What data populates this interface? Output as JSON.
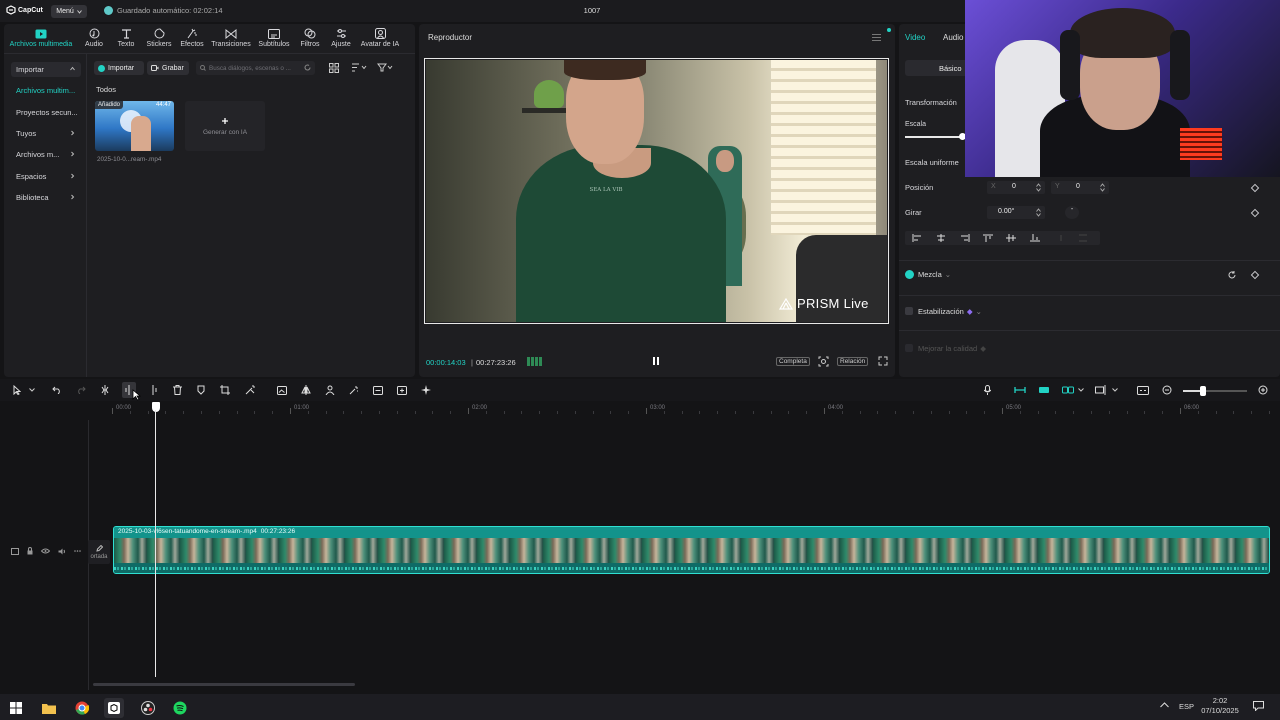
{
  "app": {
    "logo": "CapCut",
    "menu_label": "Menú",
    "autosave": "Guardado automático: 02:02:14",
    "project_title": "1007"
  },
  "media_tabs": [
    {
      "label": "Archivos multimedia",
      "icon": "media-icon"
    },
    {
      "label": "Audio",
      "icon": "audio-icon"
    },
    {
      "label": "Texto",
      "icon": "text-icon"
    },
    {
      "label": "Stickers",
      "icon": "sticker-icon"
    },
    {
      "label": "Efectos",
      "icon": "effects-icon"
    },
    {
      "label": "Transiciones",
      "icon": "transition-icon"
    },
    {
      "label": "Subtítulos",
      "icon": "subtitle-icon"
    },
    {
      "label": "Filtros",
      "icon": "filter-icon"
    },
    {
      "label": "Ajuste",
      "icon": "adjust-icon"
    },
    {
      "label": "Avatar de IA",
      "icon": "avatar-icon"
    }
  ],
  "sidebar": [
    {
      "label": "Importar"
    },
    {
      "label": "Archivos multim..."
    },
    {
      "label": "Proyectos secun..."
    },
    {
      "label": "Tuyos"
    },
    {
      "label": "Archivos m..."
    },
    {
      "label": "Espacios"
    },
    {
      "label": "Biblioteca"
    }
  ],
  "media_toolbar": {
    "import_label": "Importar",
    "record_label": "Grabar",
    "search_placeholder": "Busca diálogos, escenas o ..."
  },
  "media_grid": {
    "section_label": "Todos",
    "clip": {
      "badge": "Añadido",
      "duration": "44:47",
      "filename": "2025-10-0...ream-.mp4"
    },
    "generate_label": "Generar con IA"
  },
  "player": {
    "title": "Reproductor",
    "watermark": "PRISM Live",
    "shirt_text": "SEA LA VIB",
    "current_time": "00:00:14:03",
    "total_time": "00:27:23:26",
    "full_label": "Completa",
    "ratio_label": "Relación"
  },
  "properties": {
    "tabs": [
      "Video",
      "Audio"
    ],
    "subtab": "Básico",
    "transform_label": "Transformación",
    "scale_label": "Escala",
    "uniform_scale_label": "Escala uniforme",
    "position_label": "Posición",
    "pos_x_label": "X",
    "pos_x": "0",
    "pos_y_label": "Y",
    "pos_y": "0",
    "rotate_label": "Girar",
    "rotate_value": "0.00°",
    "rotate_extra": "-",
    "blend_label": "Mezcla",
    "stabilize_label": "Estabilización",
    "enhance_label": "Mejorar la calidad"
  },
  "timeline": {
    "ruler_labels": [
      "00:00",
      "01:00",
      "02:00",
      "03:00",
      "04:00",
      "05:00",
      "06:00"
    ],
    "track_cover_label": "ortada",
    "clip_name": "2025-10-03-vl6sen-tatuandome-en-stream-.mp4",
    "clip_duration": "00:27:23:26",
    "playhead_progress": 0.0086
  },
  "taskbar": {
    "lang": "ESP",
    "time": "2:02",
    "date": "07/10/2025"
  },
  "colors": {
    "accent": "#22d3c5",
    "clip_bg": "#16a39a",
    "panel": "#1e1e21",
    "bg": "#141416"
  }
}
